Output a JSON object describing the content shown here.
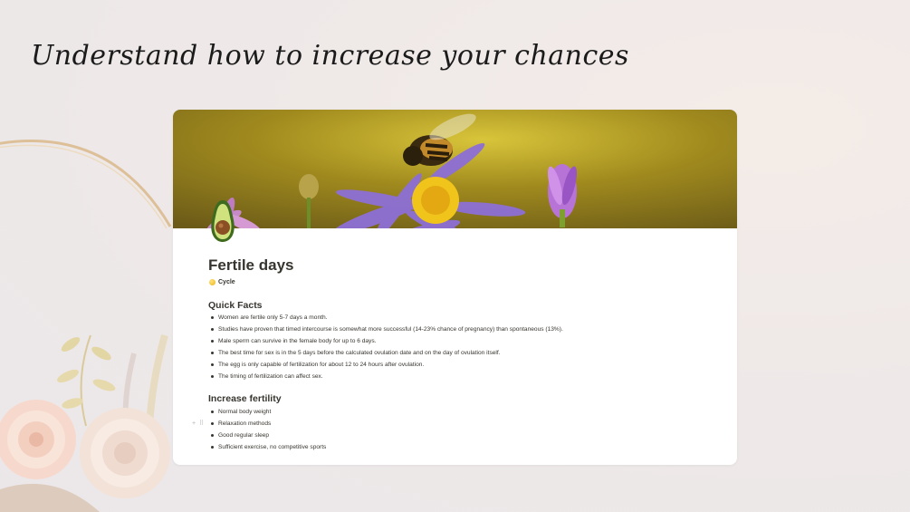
{
  "headline": "Understand how to increase your chances",
  "page": {
    "icon": "avocado-icon",
    "title": "Fertile days",
    "relation": {
      "icon": "yellow-circle-icon",
      "label": "Cycle"
    },
    "sections": [
      {
        "heading": "Quick Facts",
        "items": [
          "Women are fertile only 5-7 days a month.",
          "Studies have proven that timed intercourse is somewhat more successful (14-23% chance of pregnancy) than spontaneous (13%).",
          "Male sperm can survive in the female body for up to 6 days.",
          "The best time for sex is in the 5 days before the calculated ovulation date and on the day of ovulation itself.",
          "The egg is only capable of fertilization for about 12 to 24 hours after ovulation.",
          "The timing of fertilization can affect sex."
        ]
      },
      {
        "heading": "Increase fertility",
        "items": [
          "Normal body weight",
          "Relaxation methods",
          "Good regular sleep",
          "Sufficient exercise, no competitive sports"
        ]
      }
    ]
  },
  "block_controls": "+ ⠿",
  "colors": {
    "text": "#37352f",
    "background": "#efe9e8",
    "card": "#ffffff"
  }
}
